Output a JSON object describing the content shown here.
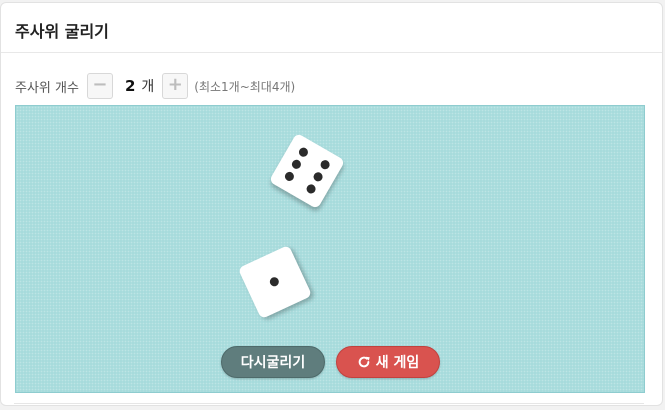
{
  "header": {
    "title": "주사위 굴리기"
  },
  "controls": {
    "label": "주사위 개수",
    "minus": "−",
    "plus": "+",
    "count": "2",
    "unit": "개",
    "range": "(최소1개~최대4개)"
  },
  "dice": [
    {
      "value": 6
    },
    {
      "value": 1
    }
  ],
  "buttons": {
    "reroll": "다시굴리기",
    "new_game": "새 게임"
  },
  "colors": {
    "board": "#a7dbdc",
    "reroll_button": "#5f7d7d",
    "new_game_button": "#d9534f"
  }
}
